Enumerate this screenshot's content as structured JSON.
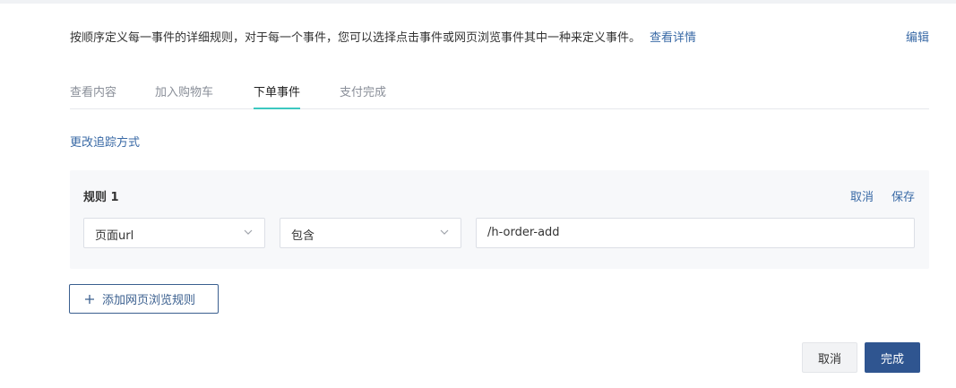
{
  "header": {
    "description": "按顺序定义每一事件的详细规则，对于每一个事件，您可以选择点击事件或网页浏览事件其中一种来定义事件。",
    "details_link": "查看详情",
    "edit_link": "编辑"
  },
  "tabs": [
    {
      "label": "查看内容",
      "active": false
    },
    {
      "label": "加入购物车",
      "active": false
    },
    {
      "label": "下单事件",
      "active": true
    },
    {
      "label": "支付完成",
      "active": false
    }
  ],
  "change_tracking_link": "更改追踪方式",
  "rule": {
    "title": "规则 1",
    "cancel_label": "取消",
    "save_label": "保存",
    "field_select": "页面url",
    "operator_select": "包含",
    "value": "/h-order-add"
  },
  "add_rule_button": {
    "label": "添加网页浏览规则",
    "icon": "plus-icon"
  },
  "footer": {
    "cancel_label": "取消",
    "done_label": "完成"
  },
  "colors": {
    "link": "#3a6aa6",
    "primary": "#2f5590",
    "tab_active_underline": "#3cc8c0",
    "panel_bg": "#f7f8fa"
  }
}
